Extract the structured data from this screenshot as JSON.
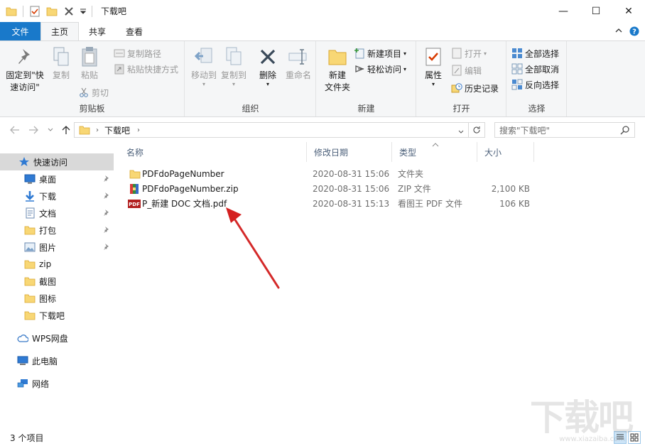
{
  "window": {
    "title": "下载吧",
    "controls": {
      "minimize": "—",
      "maximize": "☐",
      "close": "✕"
    }
  },
  "ribbon_tabs": [
    {
      "label": "文件",
      "kind": "file"
    },
    {
      "label": "主页",
      "kind": "active"
    },
    {
      "label": "共享",
      "kind": "normal"
    },
    {
      "label": "查看",
      "kind": "normal"
    }
  ],
  "ribbon": {
    "clipboard": {
      "label": "剪贴板",
      "pin_label_1": "固定到\"快",
      "pin_label_2": "速访问\"",
      "copy": "复制",
      "paste": "粘贴",
      "copy_path": "复制路径",
      "paste_shortcut": "粘贴快捷方式",
      "cut": "剪切"
    },
    "organize": {
      "label": "组织",
      "move_to": "移动到",
      "copy_to": "复制到",
      "delete": "删除",
      "rename": "重命名"
    },
    "new": {
      "label": "新建",
      "new_folder_1": "新建",
      "new_folder_2": "文件夹",
      "new_item": "新建项目",
      "easy_access": "轻松访问"
    },
    "open": {
      "label": "打开",
      "properties": "属性",
      "open": "打开",
      "edit": "编辑",
      "history": "历史记录"
    },
    "select": {
      "label": "选择",
      "select_all": "全部选择",
      "select_none": "全部取消",
      "invert": "反向选择"
    }
  },
  "address": {
    "path": "下载吧",
    "search_placeholder": "搜索\"下载吧\""
  },
  "nav": {
    "quick_access": "快速访问",
    "items": [
      {
        "label": "桌面",
        "icon": "desktop-icon",
        "pinned": true
      },
      {
        "label": "下载",
        "icon": "download-icon",
        "pinned": true
      },
      {
        "label": "文档",
        "icon": "document-icon",
        "pinned": true
      },
      {
        "label": "打包",
        "icon": "folder-icon",
        "pinned": true
      },
      {
        "label": "图片",
        "icon": "picture-icon",
        "pinned": true
      },
      {
        "label": "zip",
        "icon": "folder-icon",
        "pinned": false
      },
      {
        "label": "截图",
        "icon": "folder-icon",
        "pinned": false
      },
      {
        "label": "图标",
        "icon": "folder-icon",
        "pinned": false
      },
      {
        "label": "下载吧",
        "icon": "folder-icon",
        "pinned": false
      }
    ],
    "wps": "WPS网盘",
    "this_pc": "此电脑",
    "network": "网络"
  },
  "columns": {
    "name": "名称",
    "modified": "修改日期",
    "type": "类型",
    "size": "大小"
  },
  "files": [
    {
      "name": "PDFdoPageNumber",
      "modified": "2020-08-31 15:06",
      "type": "文件夹",
      "size": "",
      "icon": "folder-icon"
    },
    {
      "name": "PDFdoPageNumber.zip",
      "modified": "2020-08-31 15:06",
      "type": "ZIP 文件",
      "size": "2,100 KB",
      "icon": "zip-icon"
    },
    {
      "name": "P_新建 DOC 文档.pdf",
      "modified": "2020-08-31 15:13",
      "type": "看图王 PDF 文件",
      "size": "106 KB",
      "icon": "pdf-icon"
    }
  ],
  "status": {
    "count": "3 个项目"
  },
  "watermark": {
    "logo": "下载吧",
    "url": "www.xiazaiba.com"
  },
  "colors": {
    "accent": "#1979ca",
    "folder": "#f8d775",
    "arrow": "#d42020"
  }
}
